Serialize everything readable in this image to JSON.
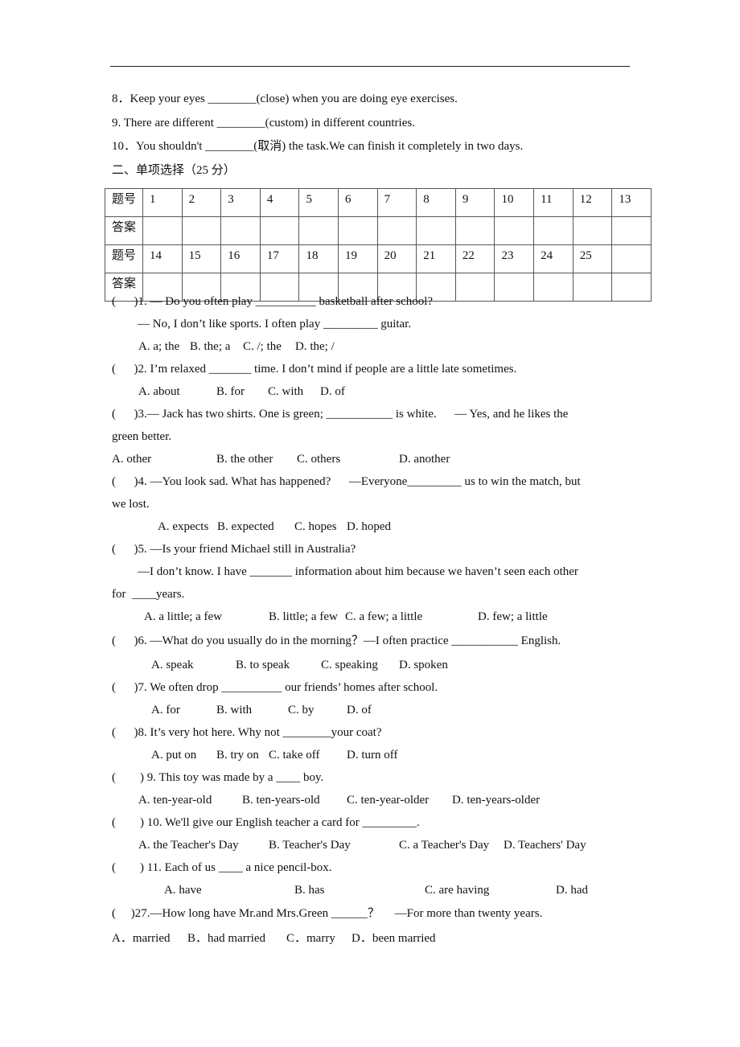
{
  "fill_in": [
    {
      "num": "8．",
      "text": "Keep your eyes ________(close) when you are doing eye exercises."
    },
    {
      "num": "9.",
      "text": "There are different ________(custom) in different countries."
    },
    {
      "num": "10．",
      "text": "You shouldn't ________(取消) the task.We can finish it completely in two days."
    }
  ],
  "section_title": "二、单项选择（25 分）",
  "answer_table": {
    "row_label_num": "题号",
    "row_label_ans": "答案",
    "row1_numbers": [
      "1",
      "2",
      "3",
      "4",
      "5",
      "6",
      "7",
      "8",
      "9",
      "10",
      "11",
      "12",
      "13"
    ],
    "row2_numbers": [
      "14",
      "15",
      "16",
      "17",
      "18",
      "19",
      "20",
      "21",
      "22",
      "23",
      "24",
      "25",
      ""
    ]
  },
  "questions": {
    "q1": {
      "line1": "(      )1. — Do you often play __________ basketball after school?",
      "line2": "— No, I don’t like sports. I often play _________ guitar.",
      "options": [
        "A. a; the",
        "B. the; a",
        "C. /; the",
        "D. the; /"
      ]
    },
    "q2": {
      "line1": "(      )2. I’m relaxed _______ time. I don’t mind if people are a little late sometimes.",
      "options": [
        "A. about",
        "B. for",
        "C. with",
        "D. of"
      ]
    },
    "q3": {
      "line1": "(      )3.— Jack has two shirts. One is green; ___________ is white.      — Yes, and he likes the",
      "line2": "green better.",
      "options": [
        "A. other",
        "B. the other",
        "C. others",
        "D. another"
      ]
    },
    "q4": {
      "line1": "(      )4. —You look sad. What has happened?      —Everyone_________ us to win the match, but",
      "line2": "we lost.",
      "options": [
        "A. expects",
        "B. expected",
        "C. hopes",
        "D. hoped"
      ]
    },
    "q5": {
      "line1": "(      )5. —Is your friend Michael still in Australia?",
      "line2": "—I don’t know. I have _______ information about him because we haven’t seen each other",
      "line3": "for  ____years.",
      "options": [
        "A. a little; a few",
        "B. little; a few",
        "C. a few; a little",
        "D. few; a little"
      ]
    },
    "q6": {
      "line1": "(      )6. —What do you usually do in the morning？—I often practice ___________ English.",
      "options": [
        "A. speak",
        "B. to speak",
        "C. speaking",
        "D. spoken"
      ]
    },
    "q7": {
      "line1": "(      )7. We often drop __________ our friends’ homes after school.",
      "options": [
        "A. for",
        "B. with",
        "C. by",
        "D. of"
      ]
    },
    "q8": {
      "line1": "(      )8. It’s very hot here. Why not ________your coat?",
      "options": [
        "A. put on",
        "B. try on",
        "C. take off",
        "D. turn off"
      ]
    },
    "q9": {
      "line1": "(        ) 9. This toy was made by a ____ boy.",
      "options": [
        "A. ten-year-old",
        "B. ten-years-old",
        "C. ten-year-older",
        "D. ten-years-older"
      ]
    },
    "q10": {
      "line1": "(        ) 10. We'll give our English teacher a card for _________.",
      "options": [
        "A. the Teacher's Day",
        "B. Teacher's Day",
        "C. a Teacher's Day",
        "D. Teachers' Day"
      ]
    },
    "q11": {
      "line1": "(        ) 11. Each of us ____ a nice pencil-box.",
      "options": [
        "A. have",
        "B. has",
        "C. are having",
        "D. had"
      ]
    },
    "q27": {
      "line1": "(     )27.—How long have Mr.and Mrs.Green ______？     —For more than twenty years.",
      "options": [
        "A．married",
        "B．had married",
        "C．marry",
        "D．been married"
      ]
    }
  }
}
